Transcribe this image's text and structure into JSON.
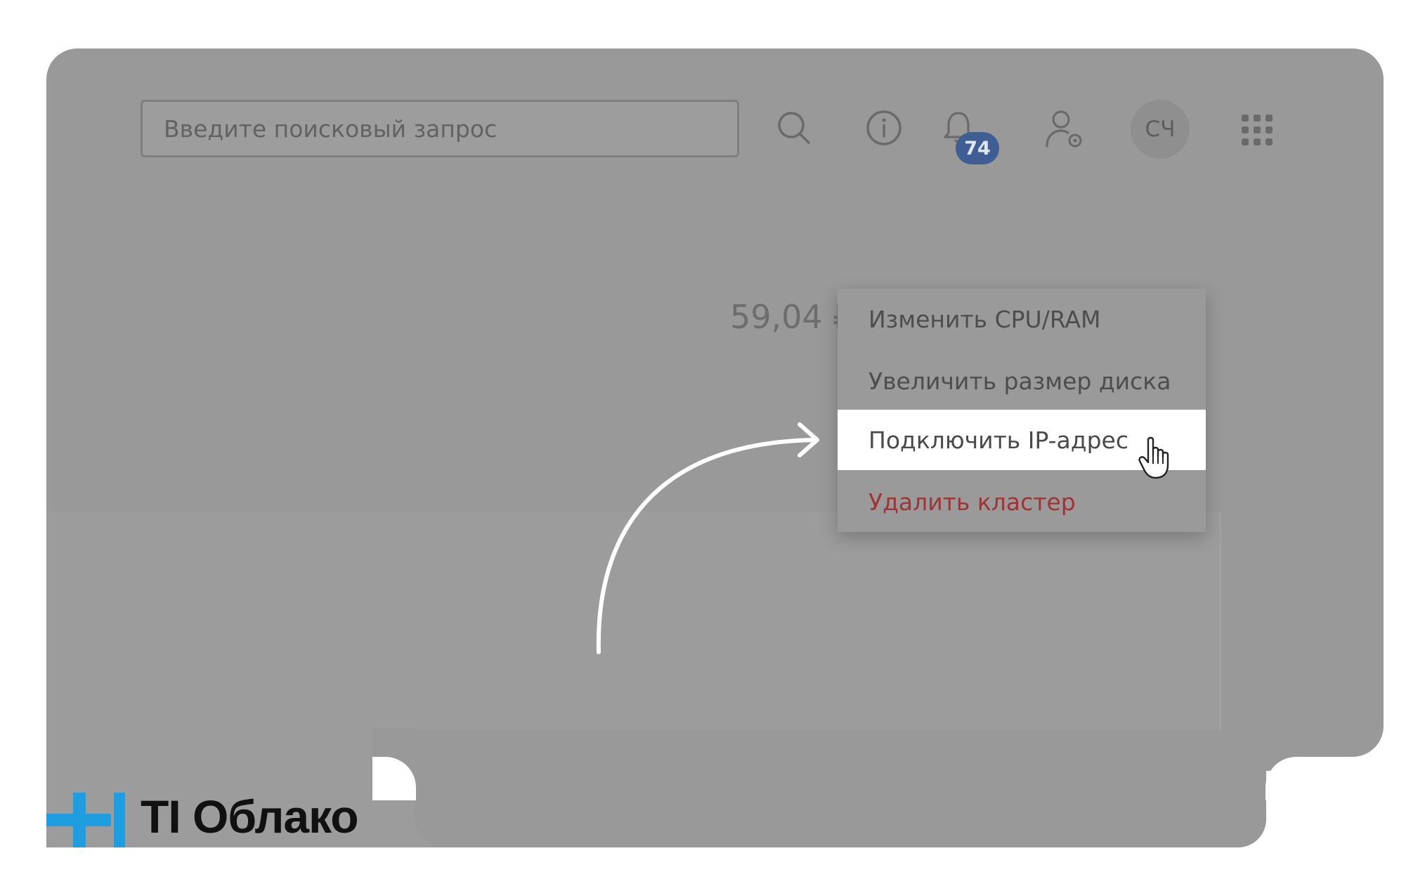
{
  "header": {
    "search_placeholder": "Введите поисковый запрос",
    "notifications_count": "74",
    "avatar_initials": "СЧ"
  },
  "price": {
    "value": "59,04 ₽"
  },
  "context_menu": {
    "items": [
      {
        "label": "Изменить CPU/RAM"
      },
      {
        "label": "Увеличить размер диска"
      },
      {
        "label": "Подключить IP-адрес"
      },
      {
        "label": "Удалить кластер"
      }
    ]
  },
  "logo": {
    "text": "TI Облако",
    "color": "#1e9de0"
  },
  "colors": {
    "overlay_gray": "#999999",
    "badge": "#3f5f94",
    "danger": "#a03434"
  }
}
